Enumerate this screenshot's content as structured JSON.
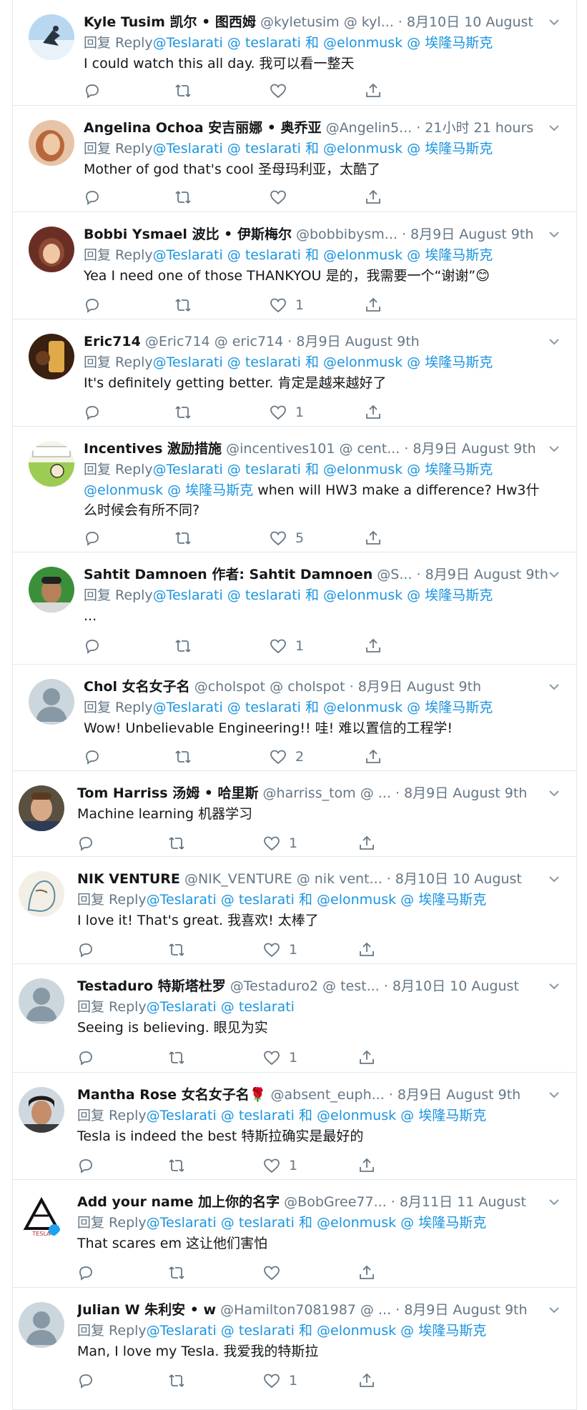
{
  "accent": "#1b95e0",
  "tweets": [
    {
      "name": "Kyle Tusim 凯尔 • 图西姆",
      "handle": "@kyletusim @ kyl...",
      "time": "· 8月10日 10 August",
      "reply_prefix": "回复  Reply",
      "reply_mentions": "@Teslarati @ teslarati 和 @elonmusk @ 埃隆马斯克",
      "text": "I could watch this all day. 我可以看一整天",
      "likes": ""
    },
    {
      "name": "Angelina Ochoa 安吉丽娜 • 奥乔亚",
      "handle": "@Angelin5...",
      "time": "· 21小时 21 hours",
      "reply_prefix": "回复  Reply",
      "reply_mentions": "@Teslarati @ teslarati 和 @elonmusk @ 埃隆马斯克",
      "text": "Mother of god that's cool 圣母玛利亚，太酷了",
      "likes": ""
    },
    {
      "name": "Bobbi Ysmael 波比 • 伊斯梅尔",
      "handle": "@bobbibysm...",
      "time": "· 8月9日 August 9th",
      "reply_prefix": "回复  Reply",
      "reply_mentions": "@Teslarati @ teslarati 和 @elonmusk @ 埃隆马斯克",
      "text": "Yea I need one of those THANKYOU 是的，我需要一个“谢谢”😊",
      "likes": "1"
    },
    {
      "name": "Eric714",
      "handle": "@Eric714 @ eric714",
      "time": "· 8月9日 August 9th",
      "reply_prefix": "回复  Reply",
      "reply_mentions": "@Teslarati @ teslarati 和 @elonmusk @ 埃隆马斯克",
      "text": "It's definitely getting better. 肯定是越来越好了",
      "likes": "1"
    },
    {
      "name": "Incentives 激励措施",
      "handle": "@incentives101 @ cent...",
      "time": "· 8月9日 August 9th",
      "reply_prefix": "回复  Reply",
      "reply_mentions": "@Teslarati @ teslarati 和 @elonmusk @ 埃隆马斯克",
      "text_mention": "@elonmusk @ 埃隆马斯克",
      "text": " when will HW3 make a difference? Hw3什么时候会有所不同?",
      "likes": "5"
    },
    {
      "name": "Sahtit Damnoen 作者: Sahtit Damnoen",
      "handle": "@S...",
      "time": "· 8月9日 August 9th",
      "reply_prefix": "回复  Reply",
      "reply_mentions": "@Teslarati @ teslarati 和 @elonmusk @ 埃隆马斯克",
      "text": "...",
      "likes": "1"
    },
    {
      "name": "Chol 女名女子名",
      "handle": "@cholspot @ cholspot",
      "time": "· 8月9日 August 9th",
      "reply_prefix": "回复  Reply",
      "reply_mentions": "@Teslarati @ teslarati 和 @elonmusk @ 埃隆马斯克",
      "text": "Wow! Unbelievable Engineering!! 哇! 难以置信的工程学!",
      "likes": "2"
    },
    {
      "name": "Tom Harriss 汤姆 • 哈里斯",
      "handle": "@harriss_tom @ ...",
      "time": "· 8月9日 August 9th",
      "reply_prefix": "",
      "reply_mentions": "",
      "text": "Machine learning 机器学习",
      "likes": "1"
    },
    {
      "name": "NIK VENTURE",
      "handle": "@NIK_VENTURE @ nik vent...",
      "time": "· 8月10日 10 August",
      "reply_prefix": "回复  Reply",
      "reply_mentions": "@Teslarati @ teslarati 和 @elonmusk @ 埃隆马斯克",
      "text": "I love it! That's great. 我喜欢! 太棒了",
      "likes": "1"
    },
    {
      "name": "Testaduro 特斯塔杜罗",
      "handle": "@Testaduro2 @ test...",
      "time": "· 8月10日 10 August",
      "reply_prefix": "回复  Reply",
      "reply_mentions": "@Teslarati @ teslarati",
      "text": "Seeing is believing. 眼见为实",
      "likes": "1"
    },
    {
      "name": "Mantha Rose 女名女子名🌹",
      "handle": "@absent_euph...",
      "time": "· 8月9日 August 9th",
      "reply_prefix": "回复  Reply",
      "reply_mentions": "@Teslarati @ teslarati 和 @elonmusk @ 埃隆马斯克",
      "text": "Tesla is indeed the best 特斯拉确实是最好的",
      "likes": "1"
    },
    {
      "name": "Add your name 加上你的名字",
      "handle": "@BobGree77...",
      "time": "· 8月11日 11 August",
      "reply_prefix": "回复  Reply",
      "reply_mentions": "@Teslarati @ teslarati 和 @elonmusk @ 埃隆马斯克",
      "text": "That scares em 这让他们害怕",
      "likes": ""
    },
    {
      "name": "Julian W 朱利安 • w",
      "handle": "@Hamilton7081987 @ ...",
      "time": "· 8月9日 August 9th",
      "reply_prefix": "回复  Reply",
      "reply_mentions": "@Teslarati @ teslarati 和 @elonmusk @ 埃隆马斯克",
      "text": "Man, I love my Tesla. 我爱我的特斯拉",
      "likes": "1"
    }
  ]
}
